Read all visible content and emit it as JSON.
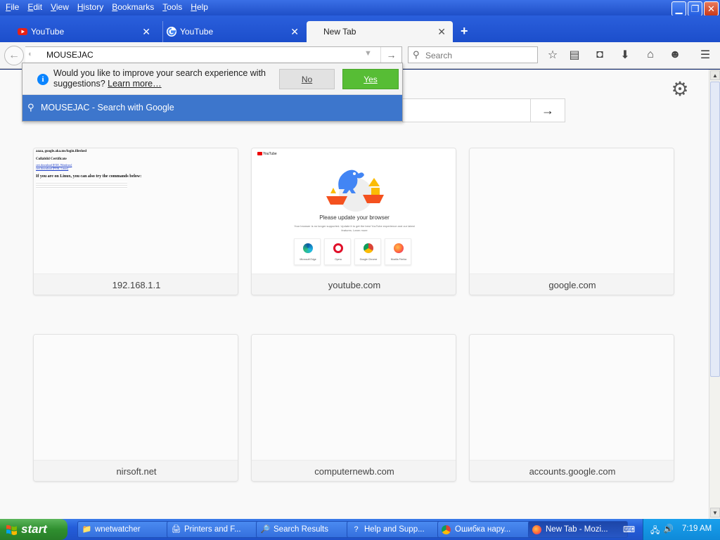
{
  "menubar": {
    "items": [
      "File",
      "Edit",
      "View",
      "History",
      "Bookmarks",
      "Tools",
      "Help"
    ]
  },
  "tabs": [
    {
      "title": "YouTube",
      "icon": "youtube-icon"
    },
    {
      "title": "YouTube",
      "icon": "google-icon"
    },
    {
      "title": "New Tab",
      "icon": "none"
    }
  ],
  "navbar": {
    "url_value": "MOUSEJAC",
    "search_placeholder": "Search"
  },
  "popup": {
    "message": "Would you like to improve your search experience with suggestions?",
    "learn_more": "Learn more…",
    "no_label": "No",
    "yes_label": "Yes",
    "result_text": "MOUSEJAC - Search with Google"
  },
  "tiles": [
    {
      "label": "192.168.1.1"
    },
    {
      "label": "youtube.com"
    },
    {
      "label": "google.com"
    },
    {
      "label": "nirsoft.net"
    },
    {
      "label": "computernewb.com"
    },
    {
      "label": "accounts.google.com"
    }
  ],
  "tile1_thumb": {
    "heading": "aaaa, google.aka.ms/login.fileshed",
    "cert_title": "Collabild Certificate",
    "link1": "cert.download [EXE, Windows]",
    "link2": "cert.download [PEM, Linux]",
    "linux_line": "If you are on Linux, you can also try the commands below:"
  },
  "tile2_thumb": {
    "logo": "YouTube",
    "title": "Please update your browser",
    "subtitle": "Your browser is no longer supported. Update it to get the best YouTube experience and our latest features. Learn more",
    "browsers": [
      "Microsoft Edge",
      "Opera",
      "Google Chrome",
      "Mozilla Firefox"
    ]
  },
  "taskbar": {
    "start_label": "start",
    "tasks": [
      {
        "label": "wnetwatcher",
        "icon": "folder-icon"
      },
      {
        "label": "Printers and F...",
        "icon": "printer-icon"
      },
      {
        "label": "Search Results",
        "icon": "search-results-icon"
      },
      {
        "label": "Help and Supp...",
        "icon": "help-icon"
      },
      {
        "label": "Ошибка нару...",
        "icon": "chrome-icon"
      },
      {
        "label": "New Tab - Mozi...",
        "icon": "firefox-icon"
      }
    ],
    "clock": "7:19 AM"
  },
  "colors": {
    "titlebar": "#2a5fdc",
    "popup_result_bg": "#3d76cc",
    "yes_button": "#57bd35",
    "taskbar": "#245dd9",
    "start_button": "#2f8f2f"
  }
}
